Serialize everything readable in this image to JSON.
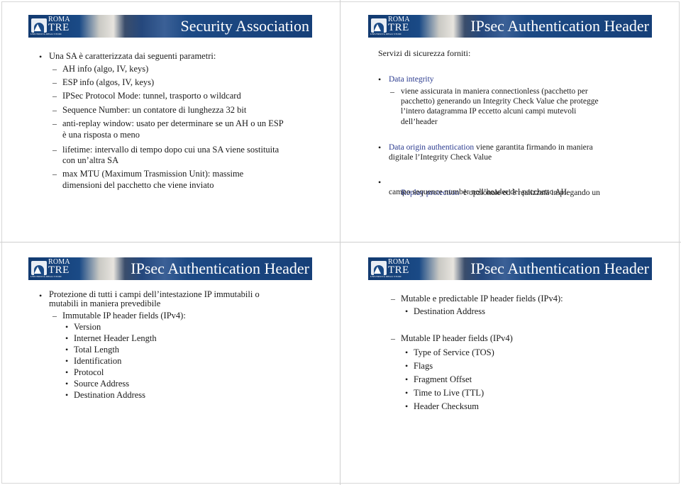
{
  "logo": {
    "line1": "ROMA",
    "line2": "TRE",
    "line3": "UNIVERSITÀ DEGLI STUDI"
  },
  "slides": [
    {
      "title": "Security Association",
      "bullet": "Una SA è caratterizzata dai seguenti parametri:",
      "subitems": [
        "AH info (algo, IV, keys)",
        "ESP info (algos, IV, keys)",
        "IPSec Protocol Mode: tunnel, trasporto o wildcard",
        "Sequence Number: un contatore di lunghezza 32 bit",
        [
          "anti-replay window: usato per determinare se un AH o un ESP",
          "è una risposta o meno"
        ],
        [
          "lifetime: intervallo di tempo dopo cui una SA viene sostituita",
          "con un’altra SA"
        ],
        [
          "max MTU (Maximum Trasmission Unit): massime",
          "dimensioni del pacchetto che viene inviato"
        ]
      ]
    },
    {
      "title": "IPsec Authentication Header",
      "intro": "Servizi di sicurezza forniti:",
      "services": [
        {
          "label": "Data integrity",
          "sub": [
            "viene assicurata in maniera connectionless (pacchetto per",
            "pacchetto) generando un Integrity Check Value che protegge",
            "l’intero datagramma IP eccetto alcuni campi mutevoli",
            "dell’header"
          ]
        },
        {
          "label": "Data origin authentication",
          "text": " viene garantita firmando in maniera",
          "text2": "digitale l’Integrity Check Value"
        },
        {
          "label": "Replay protection",
          "text": "  è opzionale ed è realizzata impiegando un",
          "text2": "campo sequence number nell’header del pacchetto AH"
        }
      ]
    },
    {
      "title": "IPsec Authentication Header",
      "bullet": [
        "Protezione di tutti i campi dell’intestazione IP immutabili o",
        "mutabili in maniera prevedibile"
      ],
      "sub": "Immutable IP header fields (IPv4):",
      "fields": [
        "Version",
        "Internet Header Length",
        "Total Length",
        "Identification",
        "Protocol",
        "Source Address",
        "Destination Address"
      ]
    },
    {
      "title": "IPsec Authentication Header",
      "group1": {
        "label": "Mutable e predictable IP header fields (IPv4):",
        "fields": [
          "Destination Address"
        ]
      },
      "group2": {
        "label": "Mutable IP header fields (IPv4)",
        "fields": [
          "Type of Service (TOS)",
          "Flags",
          "Fragment Offset",
          "Time to Live (TTL)",
          "Header Checksum"
        ]
      }
    }
  ],
  "glyphs": {
    "bullet": "•",
    "dash": "–"
  }
}
